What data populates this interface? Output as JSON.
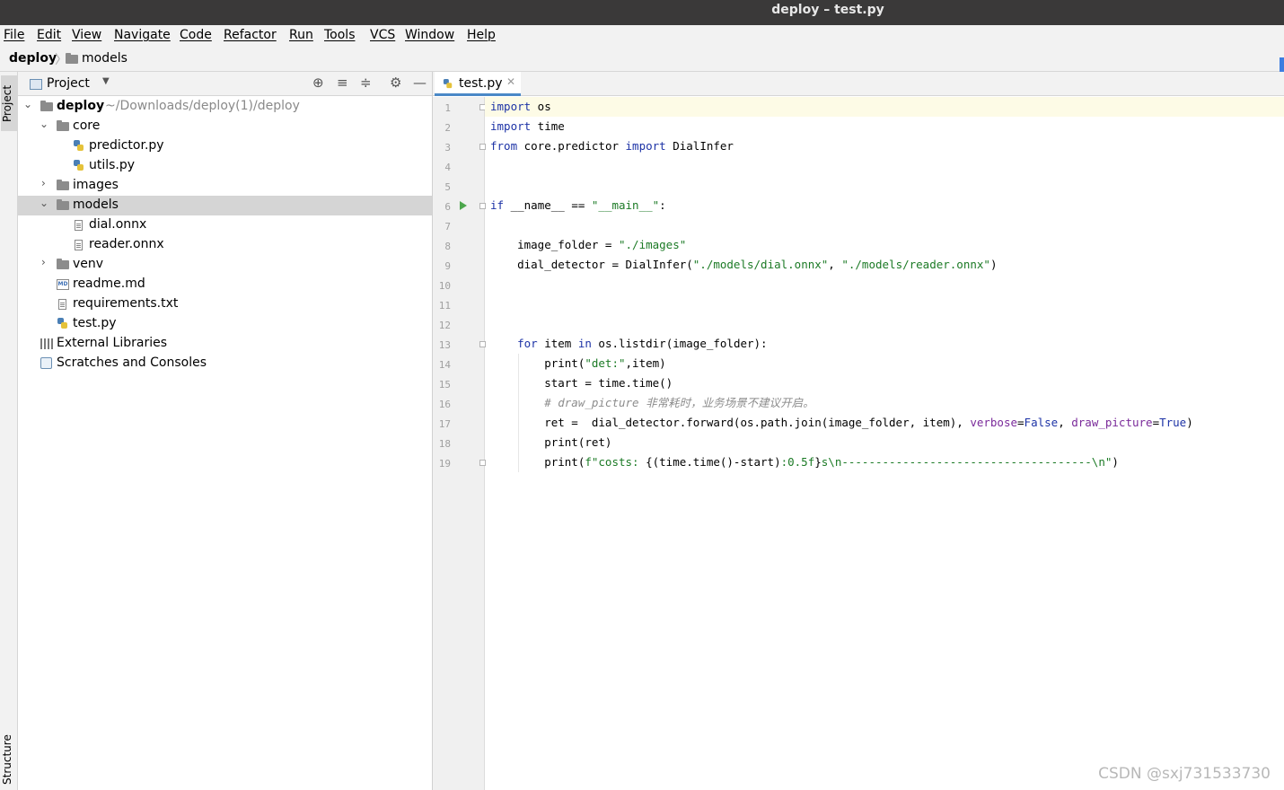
{
  "window": {
    "title": "deploy – test.py"
  },
  "menu": [
    "File",
    "Edit",
    "View",
    "Navigate",
    "Code",
    "Refactor",
    "Run",
    "Tools",
    "VCS",
    "Window",
    "Help"
  ],
  "breadcrumb": {
    "root": "deploy",
    "folder": "models"
  },
  "side_tabs": {
    "project": "Project",
    "structure": "Structure"
  },
  "project_panel": {
    "title": "Project",
    "tree": [
      {
        "label": "deploy",
        "extra": "~/Downloads/deploy(1)/deploy",
        "type": "folder",
        "depth": 0,
        "expanded": true
      },
      {
        "label": "core",
        "type": "folder",
        "depth": 1,
        "expanded": true
      },
      {
        "label": "predictor.py",
        "type": "python",
        "depth": 2
      },
      {
        "label": "utils.py",
        "type": "python",
        "depth": 2
      },
      {
        "label": "images",
        "type": "folder",
        "depth": 1,
        "expanded": false
      },
      {
        "label": "models",
        "type": "folder",
        "depth": 1,
        "expanded": true,
        "selected": true
      },
      {
        "label": "dial.onnx",
        "type": "file",
        "depth": 2
      },
      {
        "label": "reader.onnx",
        "type": "file",
        "depth": 2
      },
      {
        "label": "venv",
        "type": "folder",
        "depth": 1,
        "expanded": false
      },
      {
        "label": "readme.md",
        "type": "markdown",
        "depth": 1
      },
      {
        "label": "requirements.txt",
        "type": "file",
        "depth": 1
      },
      {
        "label": "test.py",
        "type": "python",
        "depth": 1
      },
      {
        "label": "External Libraries",
        "type": "library",
        "depth": 0
      },
      {
        "label": "Scratches and Consoles",
        "type": "scratch",
        "depth": 0
      }
    ]
  },
  "editor": {
    "tab": "test.py",
    "line_numbers": [
      "1",
      "2",
      "3",
      "4",
      "5",
      "6",
      "7",
      "8",
      "9",
      "10",
      "11",
      "12",
      "13",
      "14",
      "15",
      "16",
      "17",
      "18",
      "19"
    ],
    "code": {
      "l1_kw": "import",
      "l1_rest": " os",
      "l2_kw": "import",
      "l2_rest": " time",
      "l3_kw1": "from",
      "l3_mid": " core.predictor ",
      "l3_kw2": "import",
      "l3_rest": " DialInfer",
      "l6_kw": "if",
      "l6_mid": " __name__ == ",
      "l6_str": "\"__main__\"",
      "l6_end": ":",
      "l8_a": "    image_folder = ",
      "l8_str": "\"./images\"",
      "l9_a": "    dial_detector = DialInfer(",
      "l9_s1": "\"./models/dial.onnx\"",
      "l9_b": ", ",
      "l9_s2": "\"./models/reader.onnx\"",
      "l9_c": ")",
      "l13_ind": "    ",
      "l13_kw1": "for",
      "l13_mid": " item ",
      "l13_kw2": "in",
      "l13_rest": " os.listdir(image_folder):",
      "l14_a": "        print(",
      "l14_str": "\"det:\"",
      "l14_b": ",item)",
      "l15": "        start = time.time()",
      "l16": "        # draw_picture 非常耗时，业务场景不建议开启。",
      "l17_a": "        ret =  dial_detector.forward(os.path.join(image_folder, item), ",
      "l17_p1": "verbose",
      "l17_eq1": "=",
      "l17_v1": "False",
      "l17_b": ", ",
      "l17_p2": "draw_picture",
      "l17_eq2": "=",
      "l17_v2": "True",
      "l17_c": ")",
      "l18": "        print(ret)",
      "l19_a": "        print(",
      "l19_s1": "f\"costs: ",
      "l19_m": "{(time.time()-start)",
      "l19_s2": ":0.5f",
      "l19_m2": "}",
      "l19_s3": "s\\n-------------------------------------\\n\"",
      "l19_c": ")"
    }
  },
  "watermark": "CSDN @sxj731533730"
}
